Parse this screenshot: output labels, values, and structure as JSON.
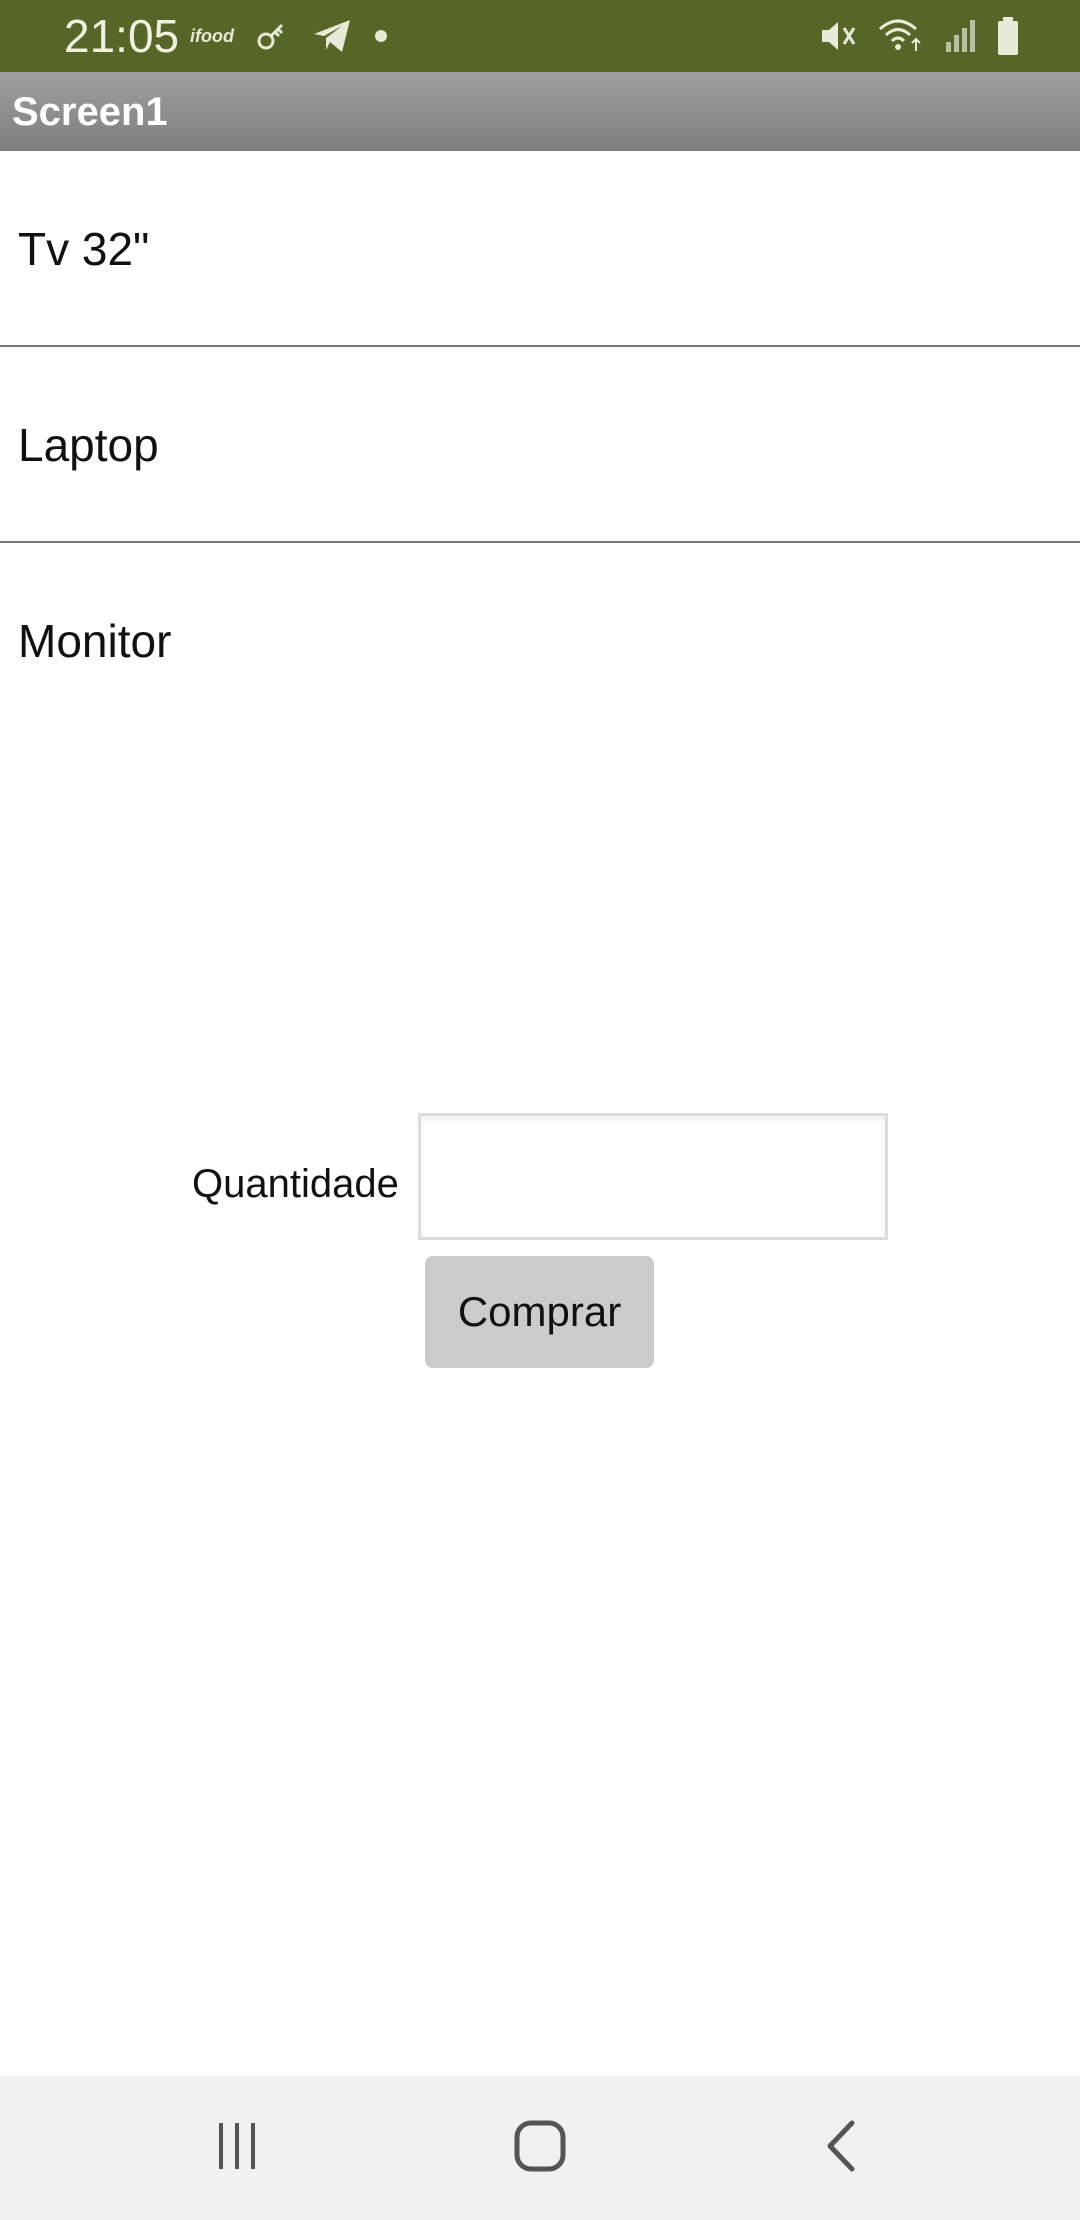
{
  "status_bar": {
    "time": "21:05",
    "ifood_label": "ifood",
    "icons_left": [
      "ifood-icon",
      "key-icon",
      "telegram-icon",
      "dot-icon"
    ],
    "icons_right": [
      "mute-icon",
      "wifi-icon",
      "signal-icon",
      "battery-icon"
    ],
    "background": "#556626"
  },
  "title_bar": {
    "title": "Screen1"
  },
  "list": {
    "items": [
      {
        "label": "Tv 32\""
      },
      {
        "label": "Laptop"
      },
      {
        "label": "Monitor"
      }
    ]
  },
  "form": {
    "quantity_label": "Quantidade",
    "quantity_value": "",
    "buy_button_label": "Comprar"
  },
  "nav_bar": {
    "icons": [
      "recent-apps-icon",
      "home-icon",
      "back-icon"
    ]
  }
}
